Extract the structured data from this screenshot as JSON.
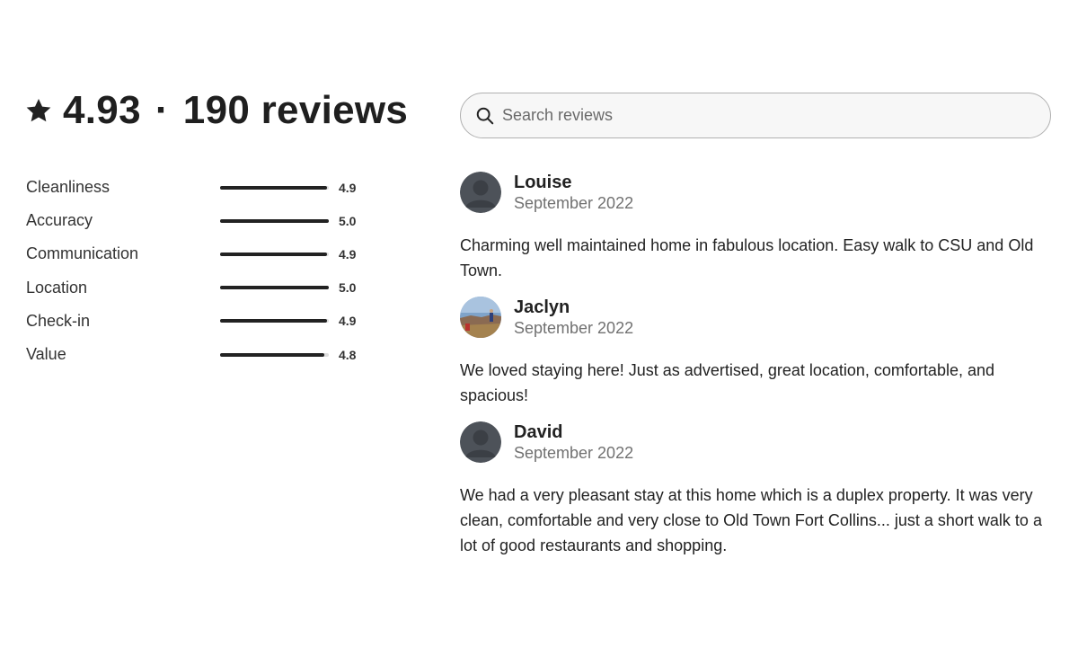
{
  "header": {
    "rating": "4.93",
    "separator": "·",
    "reviews_count": "190 reviews"
  },
  "categories": [
    {
      "label": "Cleanliness",
      "score": "4.9",
      "fill": 0.98
    },
    {
      "label": "Accuracy",
      "score": "5.0",
      "fill": 1.0
    },
    {
      "label": "Communication",
      "score": "4.9",
      "fill": 0.98
    },
    {
      "label": "Location",
      "score": "5.0",
      "fill": 1.0
    },
    {
      "label": "Check-in",
      "score": "4.9",
      "fill": 0.98
    },
    {
      "label": "Value",
      "score": "4.8",
      "fill": 0.96
    }
  ],
  "search": {
    "placeholder": "Search reviews",
    "value": ""
  },
  "reviews": [
    {
      "name": "Louise",
      "date": "September 2022",
      "text": "Charming well maintained home in fabulous location. Easy walk to CSU and Old Town."
    },
    {
      "name": "Jaclyn",
      "date": "September 2022",
      "text": "We loved staying here! Just as advertised, great location, comfortable, and spacious!"
    },
    {
      "name": "David",
      "date": "September 2022",
      "text": "We had a very pleasant stay at this home which is a duplex property. It was very clean, comfortable and very close to Old Town Fort Collins... just a short walk to a lot of good restaurants and shopping."
    }
  ],
  "icons": {
    "star": "star-icon",
    "search": "search-icon"
  },
  "colors": {
    "text": "#222222",
    "muted": "#717171",
    "bar_fill": "#222222",
    "bar_track": "#dddddd"
  }
}
